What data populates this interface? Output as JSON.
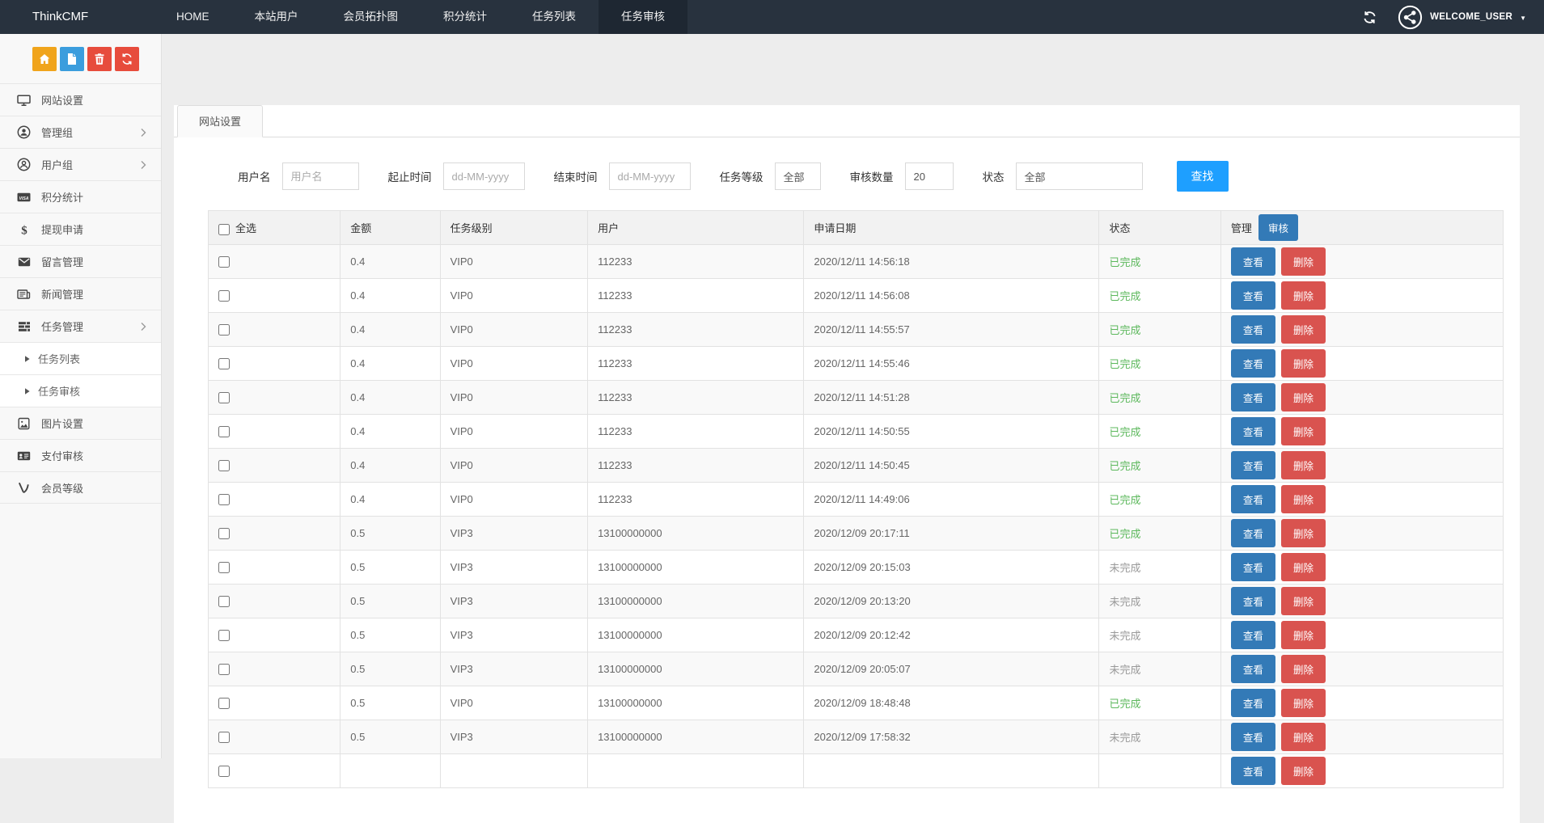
{
  "navbar": {
    "brand": "ThinkCMF",
    "items": [
      {
        "label": "HOME",
        "active": false
      },
      {
        "label": "本站用户",
        "active": false
      },
      {
        "label": "会员拓扑图",
        "active": false
      },
      {
        "label": "积分统计",
        "active": false
      },
      {
        "label": "任务列表",
        "active": false
      },
      {
        "label": "任务审核",
        "active": true
      }
    ],
    "username": "WELCOME_USER"
  },
  "sidebar": {
    "toolbar": [
      {
        "icon": "home-icon",
        "color": "#f0a41b"
      },
      {
        "icon": "file-icon",
        "color": "#3b9ddd"
      },
      {
        "icon": "trash-icon",
        "color": "#e74c3c"
      },
      {
        "icon": "recycle-icon",
        "color": "#e74c3c"
      }
    ],
    "items": [
      {
        "icon": "desktop-icon",
        "label": "网站设置"
      },
      {
        "icon": "admin-group-icon",
        "label": "管理组",
        "chevron": true
      },
      {
        "icon": "user-group-icon",
        "label": "用户组",
        "chevron": true
      },
      {
        "icon": "visa-icon",
        "label": "积分统计"
      },
      {
        "icon": "dollar-icon",
        "label": "提现申请"
      },
      {
        "icon": "envelope-icon",
        "label": "留言管理"
      },
      {
        "icon": "newspaper-icon",
        "label": "新闻管理"
      },
      {
        "icon": "tasks-icon",
        "label": "任务管理",
        "chevron": true
      },
      {
        "icon": "caret-right-icon",
        "label": "任务列表",
        "sub": true
      },
      {
        "icon": "caret-right-icon",
        "label": "任务审核",
        "sub": true
      },
      {
        "icon": "image-icon",
        "label": "图片设置"
      },
      {
        "icon": "idcard-icon",
        "label": "支付审核"
      },
      {
        "icon": "vine-icon",
        "label": "会员等级"
      }
    ]
  },
  "main": {
    "tab": "网站设置",
    "filters": {
      "username": {
        "label": "用户名",
        "placeholder": "用户名",
        "value": ""
      },
      "start_time": {
        "label": "起止时间",
        "placeholder": "dd-MM-yyyy",
        "value": ""
      },
      "end_time": {
        "label": "结束时间",
        "placeholder": "dd-MM-yyyy",
        "value": ""
      },
      "task_level": {
        "label": "任务等级",
        "value": "全部"
      },
      "audit_count": {
        "label": "审核数量",
        "value": "20"
      },
      "status": {
        "label": "状态",
        "value": "全部"
      },
      "search_label": "查找"
    },
    "table": {
      "headers": {
        "select": "全选",
        "amount": "金额",
        "level": "任务级别",
        "user": "用户",
        "date": "申请日期",
        "status": "状态",
        "manage": "管理",
        "audit": "审核"
      },
      "actions": {
        "view": "查看",
        "delete": "删除"
      },
      "rows": [
        {
          "amount": "0.4",
          "level": "VIP0",
          "user": "112233",
          "date": "2020/12/11 14:56:18",
          "status": "已完成",
          "status_done": true
        },
        {
          "amount": "0.4",
          "level": "VIP0",
          "user": "112233",
          "date": "2020/12/11 14:56:08",
          "status": "已完成",
          "status_done": true
        },
        {
          "amount": "0.4",
          "level": "VIP0",
          "user": "112233",
          "date": "2020/12/11 14:55:57",
          "status": "已完成",
          "status_done": true
        },
        {
          "amount": "0.4",
          "level": "VIP0",
          "user": "112233",
          "date": "2020/12/11 14:55:46",
          "status": "已完成",
          "status_done": true
        },
        {
          "amount": "0.4",
          "level": "VIP0",
          "user": "112233",
          "date": "2020/12/11 14:51:28",
          "status": "已完成",
          "status_done": true
        },
        {
          "amount": "0.4",
          "level": "VIP0",
          "user": "112233",
          "date": "2020/12/11 14:50:55",
          "status": "已完成",
          "status_done": true
        },
        {
          "amount": "0.4",
          "level": "VIP0",
          "user": "112233",
          "date": "2020/12/11 14:50:45",
          "status": "已完成",
          "status_done": true
        },
        {
          "amount": "0.4",
          "level": "VIP0",
          "user": "112233",
          "date": "2020/12/11 14:49:06",
          "status": "已完成",
          "status_done": true
        },
        {
          "amount": "0.5",
          "level": "VIP3",
          "user": "13100000000",
          "date": "2020/12/09 20:17:11",
          "status": "已完成",
          "status_done": true
        },
        {
          "amount": "0.5",
          "level": "VIP3",
          "user": "13100000000",
          "date": "2020/12/09 20:15:03",
          "status": "未完成",
          "status_done": false
        },
        {
          "amount": "0.5",
          "level": "VIP3",
          "user": "13100000000",
          "date": "2020/12/09 20:13:20",
          "status": "未完成",
          "status_done": false
        },
        {
          "amount": "0.5",
          "level": "VIP3",
          "user": "13100000000",
          "date": "2020/12/09 20:12:42",
          "status": "未完成",
          "status_done": false
        },
        {
          "amount": "0.5",
          "level": "VIP3",
          "user": "13100000000",
          "date": "2020/12/09 20:05:07",
          "status": "未完成",
          "status_done": false
        },
        {
          "amount": "0.5",
          "level": "VIP0",
          "user": "13100000000",
          "date": "2020/12/09 18:48:48",
          "status": "已完成",
          "status_done": true
        },
        {
          "amount": "0.5",
          "level": "VIP3",
          "user": "13100000000",
          "date": "2020/12/09 17:58:32",
          "status": "未完成",
          "status_done": false
        },
        {
          "amount": "",
          "level": "",
          "user": "",
          "date": "",
          "status": "",
          "status_done": false
        }
      ]
    }
  },
  "colors": {
    "navbar_bg": "#28323e",
    "navbar_active_bg": "#1e2732",
    "search_button_blue": "#1e9fff",
    "action_blue": "#337ab7",
    "action_red": "#d9534f",
    "status_done_green": "#5cb85c",
    "status_pending_gray": "#999999",
    "toolbar_orange": "#f0a41b",
    "toolbar_blue": "#3b9ddd",
    "toolbar_red": "#e74c3c"
  }
}
